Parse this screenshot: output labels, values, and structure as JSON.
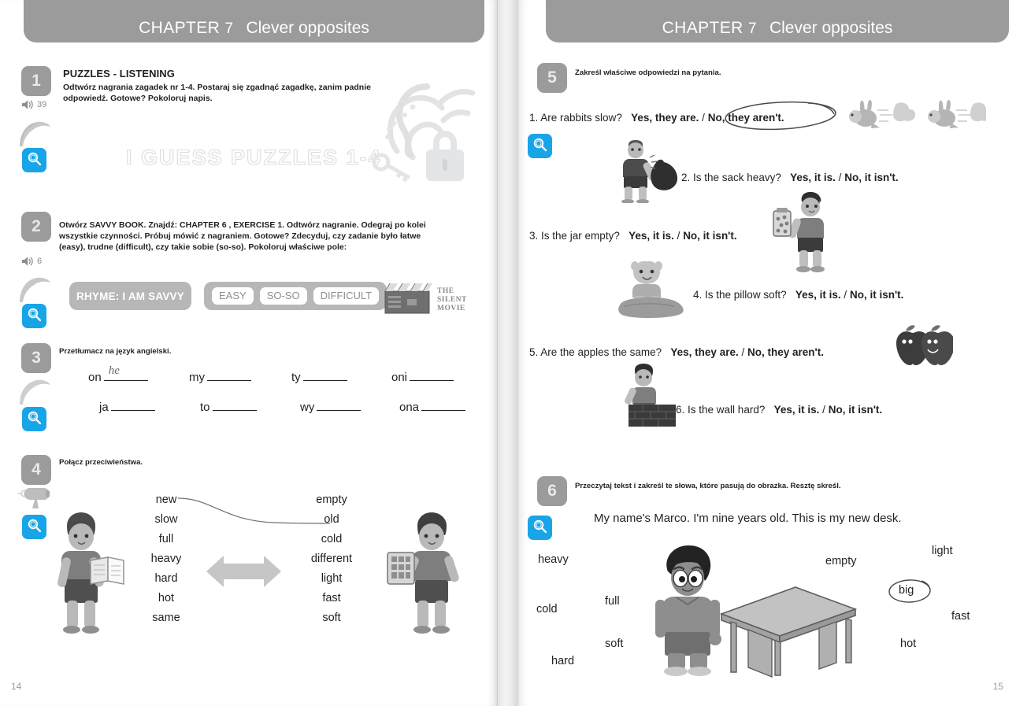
{
  "spread": {
    "chapter_label": "CHAPTER",
    "chapter_number": "7",
    "chapter_title": "Clever opposites",
    "left_page_number": "14",
    "right_page_number": "15",
    "accent_blue": "#18a5e8",
    "header_grey": "#9b9b9b"
  },
  "left_page": {
    "ex1": {
      "number": "1",
      "title": "PUZZLES - LISTENING",
      "instruction": "Odtwórz nagrania zagadek nr 1-4. Postaraj się zgadnąć zagadkę, zanim padnie odpowiedź. Gotowe? Pokoloruj napis.",
      "audio_track": "39",
      "outline_text": "I GUESS PUZZLES 1-4",
      "art": "ear-sound-key-lock"
    },
    "ex2": {
      "number": "2",
      "instruction": "Otwórz SAVVY BOOK. Znajdź: CHAPTER 6 , EXERCISE 1.  Odtwórz nagranie. Odegraj po kolei wszystkie czynności. Próbuj mówić z nagraniem. Gotowe? Zdecyduj, czy zadanie było łatwe (easy), trudne (difficult), czy takie sobie (so-so). Pokoloruj właściwe pole:",
      "audio_track": "6",
      "rhyme_pill": "RHYME: I AM SAVVY",
      "rating_options": [
        "EASY",
        "SO-SO",
        "DIFFICULT"
      ],
      "movie_label_lines": [
        "THE",
        "SILENT",
        "MOVIE"
      ]
    },
    "ex3": {
      "number": "3",
      "instruction": "Przetłumacz na język angielski.",
      "rows": [
        [
          {
            "pl": "on",
            "answer": "he"
          },
          {
            "pl": "my",
            "answer": ""
          },
          {
            "pl": "ty",
            "answer": ""
          },
          {
            "pl": "oni",
            "answer": ""
          }
        ],
        [
          {
            "pl": "ja",
            "answer": ""
          },
          {
            "pl": "to",
            "answer": ""
          },
          {
            "pl": "wy",
            "answer": ""
          },
          {
            "pl": "ona",
            "answer": ""
          }
        ]
      ]
    },
    "ex4": {
      "number": "4",
      "instruction": "Połącz przeciwieństwa.",
      "left_words": [
        "new",
        "slow",
        "full",
        "heavy",
        "hard",
        "hot",
        "same"
      ],
      "right_words": [
        "empty",
        "old",
        "cold",
        "different",
        "light",
        "fast",
        "soft"
      ],
      "drawn_match": {
        "from": "new",
        "to": "old"
      }
    }
  },
  "right_page": {
    "ex5": {
      "number": "5",
      "instruction": "Zakreśl właściwe odpowiedzi na pytania.",
      "questions": [
        {
          "n": "1.",
          "q": "Are rabbits slow?",
          "a1": "Yes, they are.",
          "a2": "No, they aren't.",
          "circled": "a2"
        },
        {
          "n": "2.",
          "q": "Is the sack heavy?",
          "a1": "Yes, it is.",
          "a2": "No, it isn't.",
          "circled": ""
        },
        {
          "n": "3.",
          "q": "Is the jar empty?",
          "a1": "Yes, it is.",
          "a2": "No, it isn't.",
          "circled": ""
        },
        {
          "n": "4.",
          "q": "Is the pillow soft?",
          "a1": "Yes, it is.",
          "a2": "No, it isn't.",
          "circled": ""
        },
        {
          "n": "5.",
          "q": "Are the apples the same?",
          "a1": "Yes, they are.",
          "a2": "No, they aren't.",
          "circled": ""
        },
        {
          "n": "6.",
          "q": "Is the wall hard?",
          "a1": "Yes, it is.",
          "a2": "No, it isn't.",
          "circled": ""
        }
      ]
    },
    "ex6": {
      "number": "6",
      "instruction": "Przeczytaj tekst i zakreśl te słowa, które pasują do obrazka. Resztę skreśl.",
      "text": "My name's Marco. I'm nine years old. This is my new desk.",
      "scattered_words": [
        "heavy",
        "cold",
        "full",
        "soft",
        "hard",
        "empty",
        "light",
        "big",
        "fast",
        "hot"
      ],
      "circled_word": "big"
    }
  }
}
